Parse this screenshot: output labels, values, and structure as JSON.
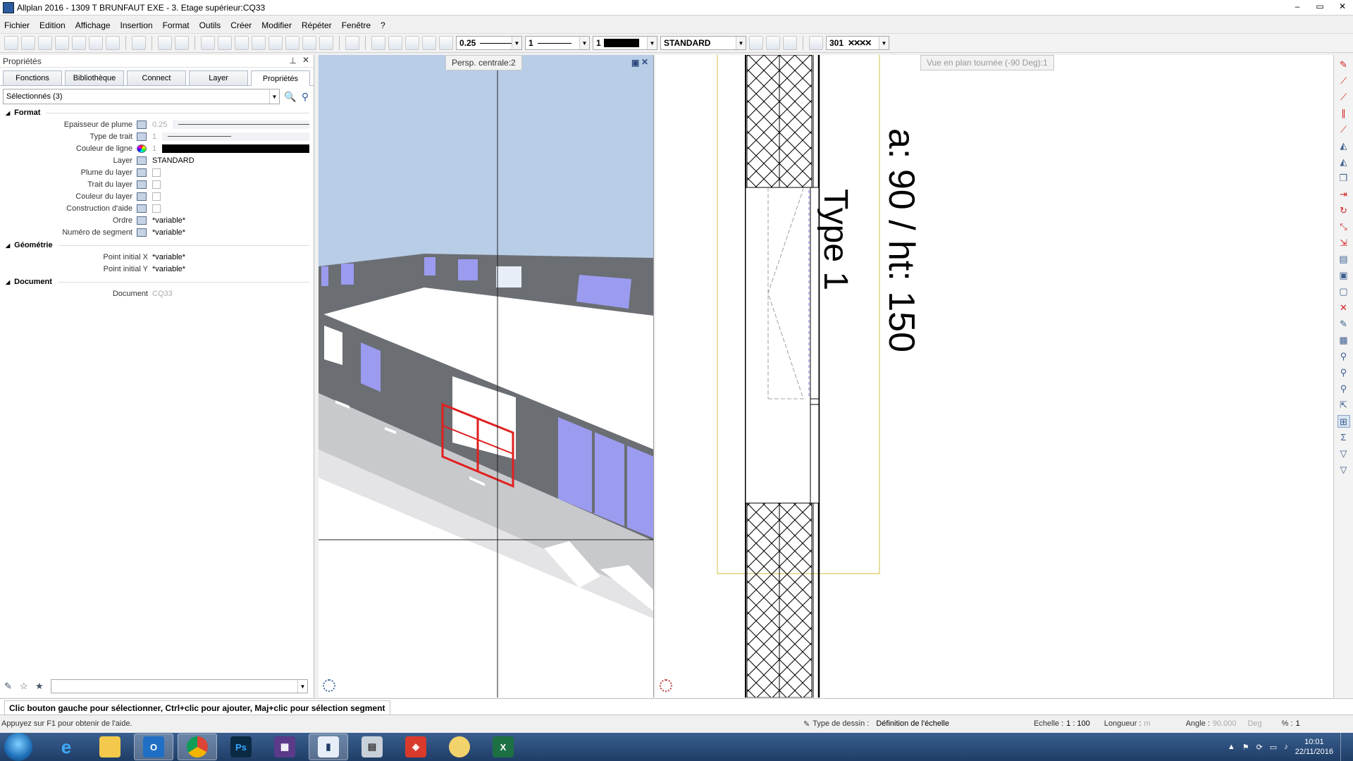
{
  "window": {
    "title": "Allplan 2016 - 1309 T BRUNFAUT EXE - 3. Etage supérieur:CQ33",
    "controls": [
      "–",
      "▭",
      "✕"
    ]
  },
  "menu": [
    "Fichier",
    "Edition",
    "Affichage",
    "Insertion",
    "Format",
    "Outils",
    "Créer",
    "Modifier",
    "Répéter",
    "Fenêtre",
    "?"
  ],
  "toolbar": {
    "pen_value": "0.25",
    "line_value": "1",
    "color_value": "1",
    "layer_value": "STANDARD",
    "hatch_value": "301"
  },
  "panel": {
    "title": "Propriétés",
    "tabs": [
      "Fonctions",
      "Bibliothèque",
      "Connect",
      "Layer",
      "Propriétés"
    ],
    "selection": "Sélectionnés (3)",
    "sections": {
      "format": "Format",
      "geometry": "Géométrie",
      "document": "Document"
    },
    "props": {
      "pen_label": "Epaisseur de plume",
      "pen_value": "0.25",
      "line_label": "Type de trait",
      "line_value": "1",
      "color_label": "Couleur de ligne",
      "color_value": "1",
      "layer_label": "Layer",
      "layer_value": "STANDARD",
      "layer_pen_label": "Plume du layer",
      "layer_line_label": "Trait du layer",
      "layer_color_label": "Couleur du layer",
      "construction_label": "Construction d'aide",
      "order_label": "Ordre",
      "order_value": "*variable*",
      "segment_label": "Numéro de segment",
      "segment_value": "*variable*",
      "startx_label": "Point initial X",
      "startx_value": "*variable*",
      "starty_label": "Point initial Y",
      "starty_value": "*variable*",
      "document_label": "Document",
      "document_value": "CQ33"
    }
  },
  "views": {
    "persp_label": "Persp. centrale:2",
    "plan_label": "Vue en plan tournée (-90 Deg):1",
    "plan_text_type": "Type 1",
    "plan_text_dims": "a: 90 / ht: 150"
  },
  "prompt": "Clic bouton gauche pour sélectionner, Ctrl+clic pour ajouter, Maj+clic pour sélection segment",
  "status": {
    "help": "Appuyez sur F1 pour obtenir de l'aide.",
    "drawing_type_label": "Type de dessin :",
    "drawing_type_value": "Définition de l'échelle",
    "scale_label": "Echelle :",
    "scale_value": "1 : 100",
    "length_label": "Longueur :",
    "length_unit": "m",
    "angle_label": "Angle :",
    "angle_value": "90.000",
    "angle_unit": "Deg",
    "percent_label": "% :",
    "percent_value": "1"
  },
  "taskbar": {
    "apps": [
      "ie-icon",
      "explorer-icon",
      "outlook-icon",
      "chrome-icon",
      "photoshop-icon",
      "media-icon",
      "allplan-icon",
      "calculator-icon",
      "sketchup-icon",
      "paint-icon",
      "excel-icon"
    ],
    "time": "10:01",
    "date": "22/11/2016"
  },
  "colors": {
    "selection_red": "#e02020",
    "sky": "#b8cde6",
    "wall_gray": "#6b6e73",
    "window_blue": "#9b9bf0",
    "plan_yellow": "#d8c860"
  }
}
